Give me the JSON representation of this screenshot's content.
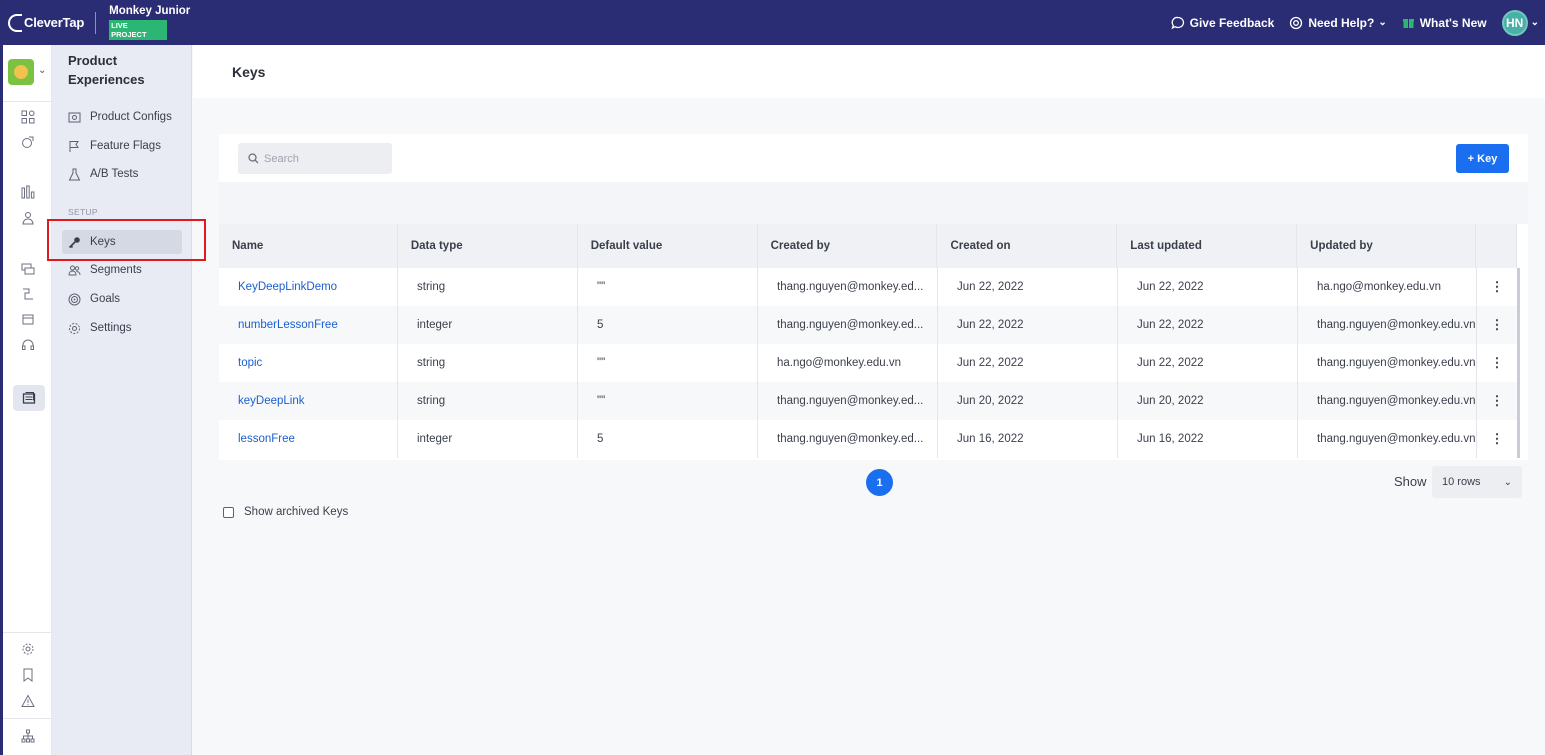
{
  "topbar": {
    "brand": "CleverTap",
    "project_name": "Monkey Junior",
    "project_badge": "LIVE PROJECT",
    "give_feedback": "Give Feedback",
    "need_help": "Need Help?",
    "whats_new": "What's New",
    "user_initials": "HN"
  },
  "sidenav": {
    "title": "Product Experiences",
    "items": [
      {
        "label": "Product Configs",
        "icon": "product-configs-icon"
      },
      {
        "label": "Feature Flags",
        "icon": "flag-icon"
      },
      {
        "label": "A/B Tests",
        "icon": "flask-icon"
      }
    ],
    "setup_label": "SETUP",
    "setup_items": [
      {
        "label": "Keys",
        "icon": "key-icon",
        "active": true
      },
      {
        "label": "Segments",
        "icon": "segments-icon"
      },
      {
        "label": "Goals",
        "icon": "goal-icon"
      },
      {
        "label": "Settings",
        "icon": "gear-icon"
      }
    ]
  },
  "page": {
    "title": "Keys",
    "search_placeholder": "Search",
    "add_button": "+ Key"
  },
  "table": {
    "columns": [
      "Name",
      "Data type",
      "Default value",
      "Created by",
      "Created on",
      "Last updated",
      "Updated by"
    ],
    "rows": [
      {
        "name": "KeyDeepLinkDemo",
        "type": "string",
        "default": "\"\"",
        "created_by": "thang.nguyen@monkey.ed...",
        "created_on": "Jun 22, 2022",
        "last_updated": "Jun 22, 2022",
        "updated_by": "ha.ngo@monkey.edu.vn"
      },
      {
        "name": "numberLessonFree",
        "type": "integer",
        "default": "5",
        "created_by": "thang.nguyen@monkey.ed...",
        "created_on": "Jun 22, 2022",
        "last_updated": "Jun 22, 2022",
        "updated_by": "thang.nguyen@monkey.edu.vn"
      },
      {
        "name": "topic",
        "type": "string",
        "default": "\"\"",
        "created_by": "ha.ngo@monkey.edu.vn",
        "created_on": "Jun 22, 2022",
        "last_updated": "Jun 22, 2022",
        "updated_by": "thang.nguyen@monkey.edu.vn"
      },
      {
        "name": "keyDeepLink",
        "type": "string",
        "default": "\"\"",
        "created_by": "thang.nguyen@monkey.ed...",
        "created_on": "Jun 20, 2022",
        "last_updated": "Jun 20, 2022",
        "updated_by": "thang.nguyen@monkey.edu.vn"
      },
      {
        "name": "lessonFree",
        "type": "integer",
        "default": "5",
        "created_by": "thang.nguyen@monkey.ed...",
        "created_on": "Jun 16, 2022",
        "last_updated": "Jun 16, 2022",
        "updated_by": "thang.nguyen@monkey.edu.vn"
      }
    ],
    "row_menu": "⋮"
  },
  "pagination": {
    "current_page": "1",
    "show_label": "Show",
    "rows_value": "10 rows"
  },
  "archived_label": "Show archived Keys",
  "colors": {
    "topbar": "#2a2d74",
    "accent": "#1a6ef0",
    "link": "#1a5fd0",
    "live_badge": "#2bb673",
    "highlight_box": "#e0191f"
  }
}
